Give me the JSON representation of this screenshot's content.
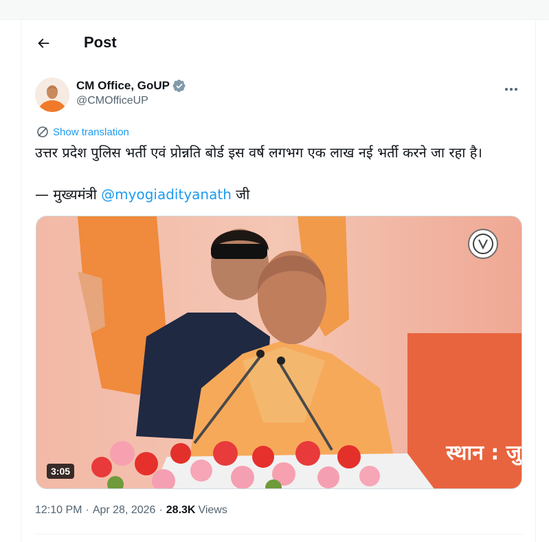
{
  "header": {
    "title": "Post"
  },
  "author": {
    "display_name": "CM Office, GoUP",
    "handle": "@CMOfficeUP",
    "verified": true
  },
  "post": {
    "show_translation": "Show translation",
    "text": "उत्तर प्रदेश पुलिस भर्ती एवं प्रोन्नति बोर्ड इस वर्ष लगभग एक लाख नई भर्ती करने जा रहा है।",
    "quote_prefix": "— मुख्यमंत्री",
    "mention": "@myogiadityanath",
    "quote_suffix": "जी"
  },
  "media": {
    "duration": "3:05",
    "stage_text": "स्थान : जु"
  },
  "meta": {
    "time": "12:10 PM",
    "date": "Apr 28, 2026",
    "views_count": "28.3K",
    "views_label": "Views"
  },
  "colors": {
    "accent": "#1d9bf0",
    "verified_badge": "#829aab",
    "stage_orange": "#e8643e"
  }
}
